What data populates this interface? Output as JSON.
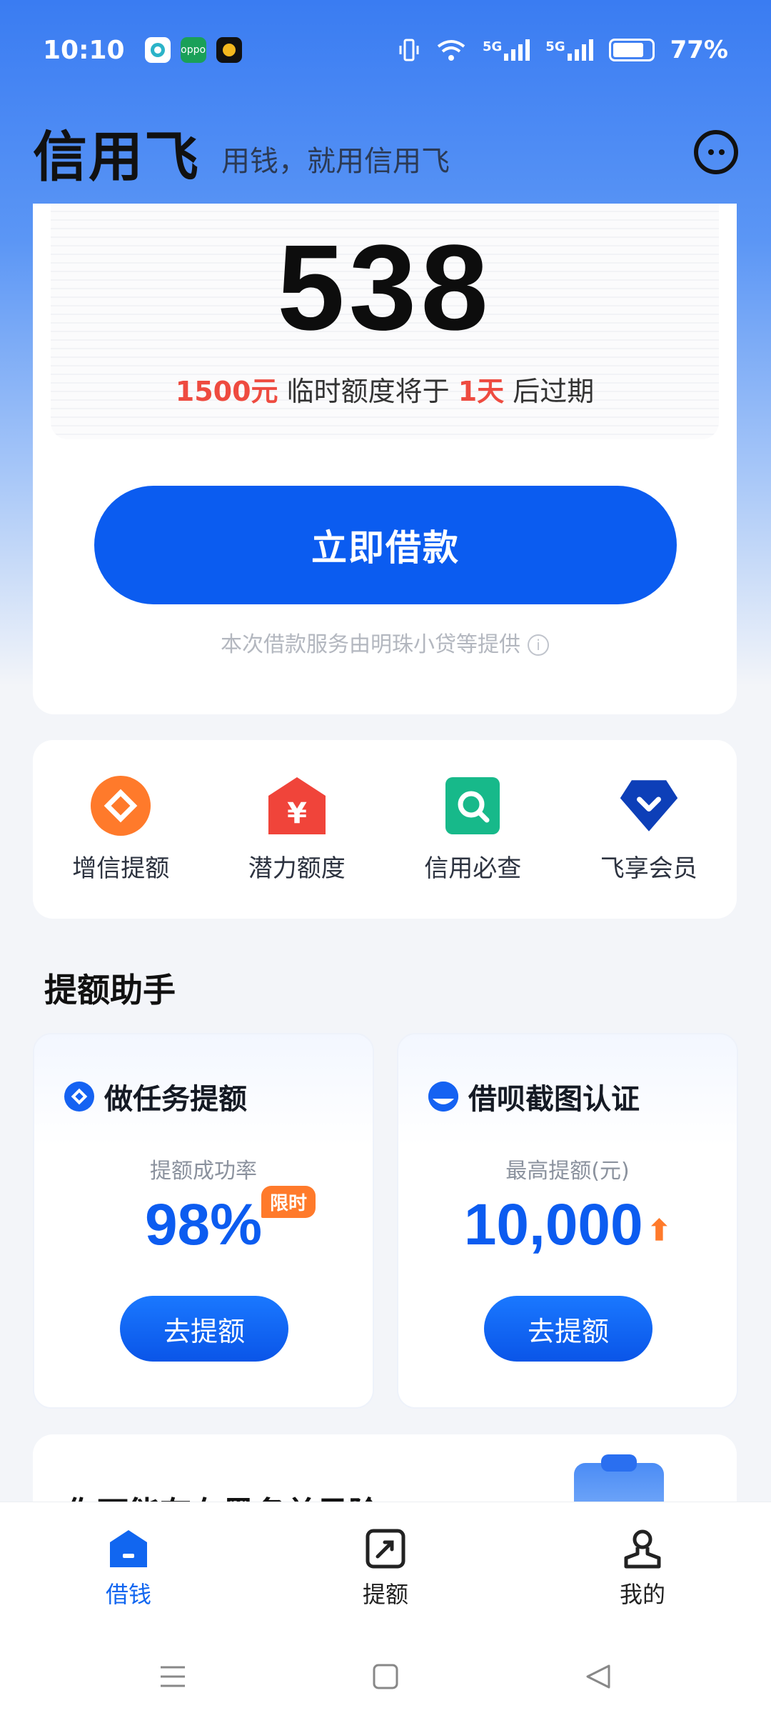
{
  "status_bar": {
    "time": "10:10",
    "network_1": "5G",
    "network_2": "5G",
    "battery": "77%"
  },
  "header": {
    "brand": "信用飞",
    "slogan": "用钱，就用信用飞"
  },
  "credit": {
    "score": "538",
    "temp_amount": "1500元",
    "temp_text": " 临时额度将于 ",
    "days": "1天",
    "expire_text": " 后过期",
    "borrow_button": "立即借款",
    "provider_note": "本次借款服务由明珠小贷等提供"
  },
  "quick_menu": [
    {
      "label": "增信提额",
      "icon": "diamond-icon"
    },
    {
      "label": "潜力额度",
      "icon": "yuan-house-icon"
    },
    {
      "label": "信用必查",
      "icon": "search-icon"
    },
    {
      "label": "飞享会员",
      "icon": "member-badge-icon"
    }
  ],
  "assistant": {
    "title": "提额助手",
    "task_card": {
      "title": "做任务提额",
      "subtitle": "提额成功率",
      "value": "98%",
      "tag": "限时",
      "button": "去提额"
    },
    "screenshot_card": {
      "title": "借呗截图认证",
      "subtitle": "最高提额(元)",
      "value": "10,000",
      "button": "去提额"
    }
  },
  "risk": {
    "title": "你可能存在黑名单风险"
  },
  "tab_bar": [
    {
      "label": "借钱",
      "active": true
    },
    {
      "label": "提额",
      "active": false
    },
    {
      "label": "我的",
      "active": false
    }
  ],
  "colors": {
    "primary": "#0b5cf0",
    "accent_red": "#ee4b40",
    "accent_orange": "#ff7a2b"
  }
}
